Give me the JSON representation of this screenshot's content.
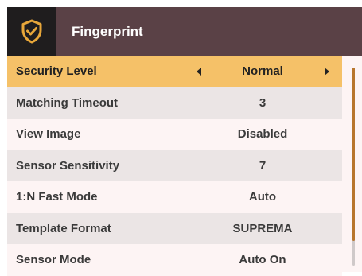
{
  "header": {
    "title": "Fingerprint",
    "icon": "fingerprint-shield-icon"
  },
  "colors": {
    "header_bg": "#5a4146",
    "icon_box_bg": "#1f1d1e",
    "accent": "#e8a73a",
    "selected_row": "#f5c168",
    "scroll_thumb": "#b8762d"
  },
  "settings": [
    {
      "label": "Security Level",
      "value": "Normal",
      "selected": true
    },
    {
      "label": "Matching Timeout",
      "value": "3"
    },
    {
      "label": "View Image",
      "value": "Disabled"
    },
    {
      "label": "Sensor Sensitivity",
      "value": "7"
    },
    {
      "label": "1:N Fast Mode",
      "value": "Auto"
    },
    {
      "label": "Template Format",
      "value": "SUPREMA"
    },
    {
      "label": "Sensor Mode",
      "value": "Auto On"
    }
  ]
}
